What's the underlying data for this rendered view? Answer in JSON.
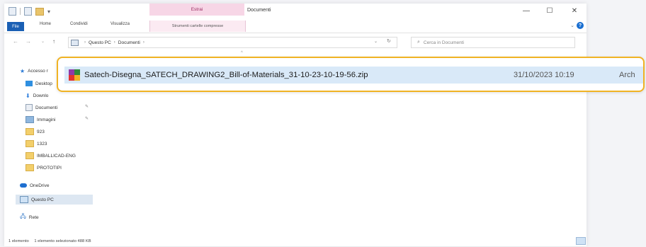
{
  "window": {
    "title": "Documenti",
    "context_group": "Estrai",
    "minimize": "—",
    "maximize": "☐",
    "close": "✕"
  },
  "ribbon": {
    "tabs": [
      "File",
      "Home",
      "Condividi",
      "Visualizza"
    ],
    "context_tab": "Strumenti cartelle compresse",
    "collapse": "⌄",
    "help": "?"
  },
  "address": {
    "back": "←",
    "forward": "→",
    "dropdown": "⌄",
    "up": "↑",
    "breadcrumb": [
      "Questo PC",
      "Documenti"
    ],
    "separator": "›",
    "refresh": "↻",
    "search_placeholder": "Cerca in Documenti"
  },
  "nav_pane": {
    "items": [
      {
        "label": "Accesso r",
        "icon": "star-icon"
      },
      {
        "label": "Desktop",
        "icon": "desktop-icon"
      },
      {
        "label": "Downlo",
        "icon": "download-icon"
      },
      {
        "label": "Documenti",
        "icon": "document-icon"
      },
      {
        "label": "Immagini",
        "icon": "pictures-icon"
      },
      {
        "label": "923",
        "icon": "folder-icon"
      },
      {
        "label": "1323",
        "icon": "folder-icon"
      },
      {
        "label": "IMBALLICAD-ENG",
        "icon": "folder-icon"
      },
      {
        "label": "PROTOTIPI",
        "icon": "folder-icon"
      },
      {
        "label": "OneDrive",
        "icon": "cloud-icon"
      },
      {
        "label": "Questo PC",
        "icon": "pc-icon"
      },
      {
        "label": "Rete",
        "icon": "network-icon"
      }
    ],
    "pin": "✎"
  },
  "files": [
    {
      "name": "Satech-Disegna_SATECH_DRAWING2_Bill-of-Materials_31-10-23-10-19-56.zip",
      "date": "31/10/2023 10:19",
      "type": "Arch",
      "icon": "winrar-archive-icon"
    }
  ],
  "status": {
    "count": "1 elemento",
    "selection": "1 elemento selezionato  488 KB"
  },
  "colors": {
    "highlight_border": "#f0b324",
    "selection_bg": "#d9e9f8",
    "file_tab": "#1a5fb4",
    "context_tab": "#f7d6e6"
  }
}
